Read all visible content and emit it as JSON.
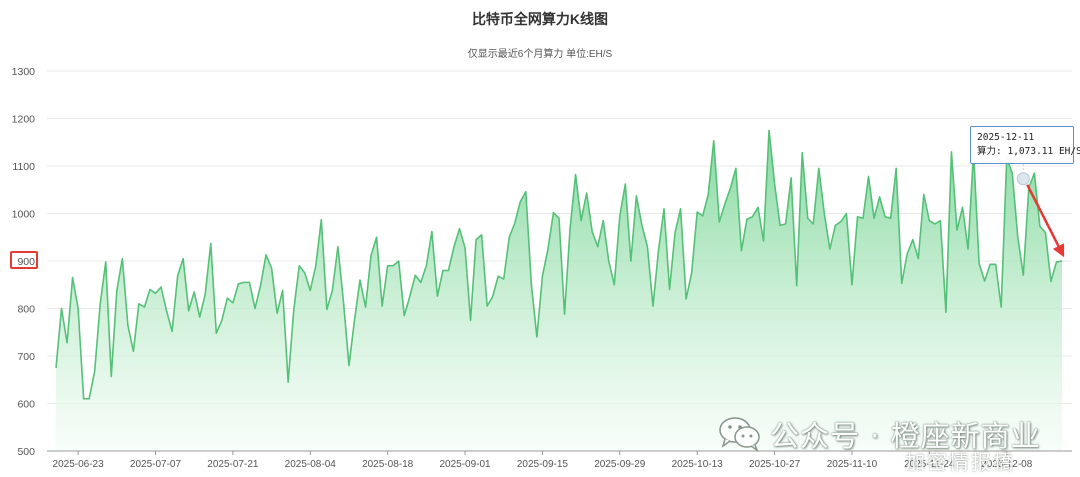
{
  "chart_data": {
    "type": "area",
    "title": "比特币全网算力K线图",
    "subtitle": "仅显示最近6个月算力 单位:EH/S",
    "xlabel": "",
    "ylabel": "",
    "ylim": [
      500,
      1300
    ],
    "yticks": [
      500,
      600,
      700,
      800,
      900,
      1000,
      1100,
      1200,
      1300
    ],
    "x_tick_labels": [
      "2025-06-23",
      "2025-07-07",
      "2025-07-21",
      "2025-08-04",
      "2025-08-18",
      "2025-09-01",
      "2025-09-15",
      "2025-09-29",
      "2025-10-13",
      "2025-10-27",
      "2025-11-10",
      "2025-11-24",
      "2025-12-08"
    ],
    "start_date": "2025-06-19",
    "grid": true,
    "line_color": "#55c077",
    "fill_top_color": "#7ed79a",
    "fill_bottom_color": "#f3fcf5",
    "values": [
      675,
      800,
      728,
      865,
      800,
      610,
      610,
      668,
      810,
      898,
      657,
      837,
      905,
      765,
      710,
      810,
      803,
      840,
      832,
      845,
      795,
      752,
      868,
      905,
      795,
      835,
      782,
      830,
      937,
      748,
      775,
      822,
      812,
      852,
      855,
      855,
      800,
      848,
      913,
      885,
      790,
      838,
      645,
      795,
      890,
      875,
      838,
      890,
      987,
      798,
      838,
      930,
      815,
      680,
      775,
      860,
      803,
      912,
      950,
      805,
      890,
      890,
      900,
      785,
      825,
      870,
      855,
      890,
      962,
      826,
      880,
      880,
      930,
      968,
      928,
      775,
      945,
      955,
      805,
      825,
      868,
      862,
      950,
      980,
      1025,
      1046,
      850,
      740,
      868,
      925,
      1002,
      990,
      788,
      968,
      1082,
      985,
      1043,
      962,
      930,
      985,
      900,
      850,
      995,
      1062,
      900,
      1037,
      975,
      930,
      805,
      922,
      1010,
      840,
      960,
      1010,
      820,
      875,
      1003,
      995,
      1040,
      1153,
      982,
      1020,
      1053,
      1095,
      922,
      988,
      993,
      1013,
      942,
      1175,
      1063,
      975,
      978,
      1075,
      848,
      1128,
      990,
      978,
      1095,
      1000,
      925,
      975,
      983,
      1000,
      850,
      993,
      990,
      1078,
      990,
      1035,
      993,
      990,
      1095,
      853,
      915,
      945,
      905,
      1040,
      985,
      978,
      985,
      792,
      1130,
      965,
      1013,
      925,
      1130,
      895,
      858,
      893,
      893,
      803,
      1118,
      1085,
      950,
      870,
      1055,
      1085,
      973,
      960,
      857,
      898,
      900
    ],
    "tooltip": {
      "date": "2025-12-11",
      "label": "算力",
      "value_text": "1,073.11 EH/S",
      "value": 1073.11
    },
    "highlighted_tick": 900
  },
  "annotations": {
    "arrow_color": "#e53935"
  },
  "watermark": {
    "text": "公众号 · 橙座新商业",
    "overlay_text": "加密情报橋",
    "icon": "wechat-icon"
  }
}
